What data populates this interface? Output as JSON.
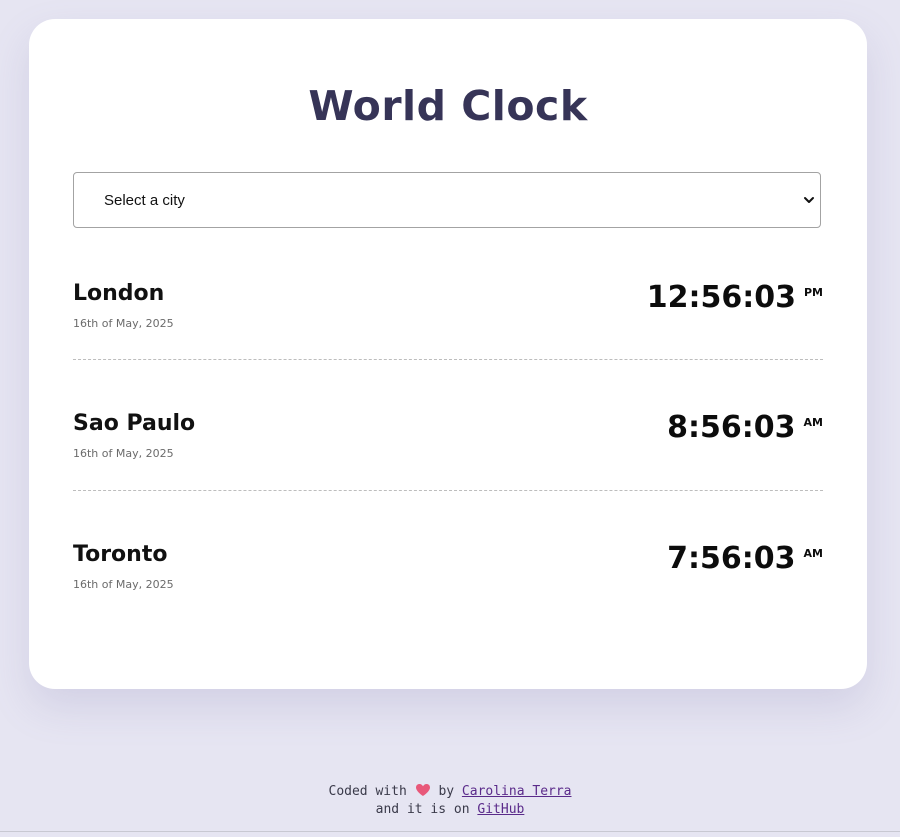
{
  "app": {
    "title": "World Clock"
  },
  "city_select": {
    "selected": "Select a city"
  },
  "cities": [
    {
      "name": "London",
      "date": "16th of May, 2025",
      "time": "12:56:03",
      "ampm": "PM"
    },
    {
      "name": "Sao Paulo",
      "date": "16th of May, 2025",
      "time": "8:56:03",
      "ampm": "AM"
    },
    {
      "name": "Toronto",
      "date": "16th of May, 2025",
      "time": "7:56:03",
      "ampm": "AM"
    }
  ],
  "footer": {
    "prefix": "Coded with",
    "heart_icon": "heart-icon",
    "by": "by",
    "author": "Carolina Terra",
    "line2_prefix": "and it is on",
    "repo_link": "GitHub"
  },
  "colors": {
    "background": "#e6e5f2",
    "card": "#ffffff",
    "title": "#363457",
    "heart": "#e8587a",
    "link": "#5a2a8a"
  }
}
